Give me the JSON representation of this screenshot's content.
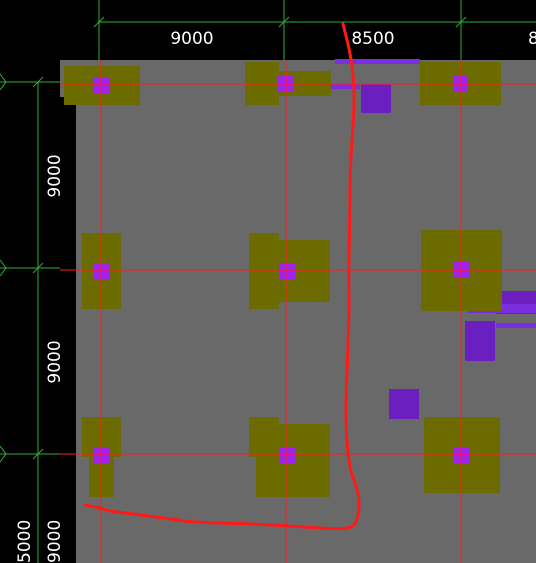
{
  "drawing": {
    "top_dimensions": [
      "9000",
      "8500",
      "8"
    ],
    "left_dimensions": [
      "9000",
      "9000",
      "5000",
      "9000"
    ]
  },
  "colors": {
    "background": "#000000",
    "slab": "#696969",
    "footing": "#6b6b00",
    "column": "#a020f0",
    "equipment": "#6b1fc0",
    "grid_line": "#ff2020",
    "dimension_line": "#2fae2f",
    "markup": "#ff1a1a",
    "text": "#ffffff"
  }
}
